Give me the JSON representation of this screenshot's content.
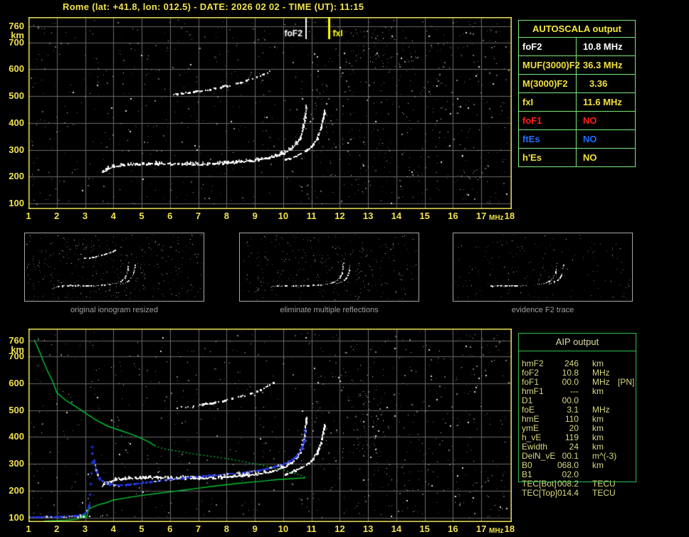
{
  "title": "Rome (lat: +41.8, lon: 012.5) - DATE: 2026 02 02 - TIME (UT): 11:15",
  "colors": {
    "background": "#000000",
    "axis_label": "#F0E24C",
    "plot_border": "#EFE45C",
    "grid": "#6A6A6A",
    "trace_white": "#FFFFFF",
    "trace_dim": "#C8C8C8",
    "noise_gray": "#8E8E8E",
    "noise_white": "#E8E8E8",
    "profile_green": "#00C832",
    "restored_blue": "#2438E6",
    "fof2_marker": "#FFFFFF",
    "fxi_marker": "#FFFF00",
    "autoscala_border": "#7CE87C",
    "autoscala_header": "#F5E93D",
    "aip_border": "#2FBF4F",
    "aip_text": "#D8D882",
    "white": "#FFFFFF",
    "yellow": "#F0E040",
    "red": "#FF2020",
    "blue": "#1E6EFF",
    "thumb_label": "#A0A0A0"
  },
  "axes": {
    "x_ticks": [
      1,
      2,
      3,
      4,
      5,
      6,
      7,
      8,
      9,
      10,
      11,
      12,
      13,
      14,
      15,
      16,
      17,
      18
    ],
    "x_unit": "MHz",
    "y_ticks": [
      760,
      700,
      600,
      500,
      400,
      300,
      200,
      100
    ],
    "y_unit": "km"
  },
  "autoscala": {
    "header": "AUTOSCALA output",
    "rows": [
      {
        "label": "foF2",
        "value": "10.8 MHz",
        "color": "white",
        "indent": false
      },
      {
        "label": "MUF(3000)F2",
        "value": "36.3 MHz",
        "color": "yellow",
        "indent": false
      },
      {
        "label": "M(3000)F2",
        "value": "3.36",
        "color": "yellow",
        "indent": true
      },
      {
        "label": "fxI",
        "value": "11.6 MHz",
        "color": "yellow",
        "indent": false
      },
      {
        "label": "foF1",
        "value": "NO",
        "color": "red",
        "indent": false
      },
      {
        "label": "ftEs",
        "value": "NO",
        "color": "blue",
        "indent": false
      },
      {
        "label": "h'Es",
        "value": "NO",
        "color": "yellow",
        "indent": false
      }
    ]
  },
  "aip": {
    "header": "AIP output",
    "rows": [
      {
        "name": "hmF2",
        "value": "246",
        "unit": "km",
        "extra": ""
      },
      {
        "name": "foF2",
        "value": "10.8",
        "unit": "MHz",
        "extra": ""
      },
      {
        "name": "foF1",
        "value": "00.0",
        "unit": "MHz",
        "extra": "[PN]"
      },
      {
        "name": "hmF1",
        "value": "---",
        "unit": "km",
        "extra": ""
      },
      {
        "name": "D1",
        "value": "00.0",
        "unit": "",
        "extra": ""
      },
      {
        "name": "foE",
        "value": "3.1",
        "unit": "MHz",
        "extra": ""
      },
      {
        "name": "hmE",
        "value": "110",
        "unit": "km",
        "extra": ""
      },
      {
        "name": "ymE",
        "value": "20",
        "unit": "km",
        "extra": ""
      },
      {
        "name": "h_vE",
        "value": "119",
        "unit": "km",
        "extra": ""
      },
      {
        "name": "Ewidth",
        "value": "24",
        "unit": "km",
        "extra": ""
      },
      {
        "name": "DelN_vE",
        "value": "00.1",
        "unit": "m^(-3)",
        "extra": ""
      },
      {
        "name": "B0",
        "value": "068.0",
        "unit": "km",
        "extra": ""
      },
      {
        "name": "B1",
        "value": "02.0",
        "unit": "",
        "extra": ""
      },
      {
        "name": "TEC[Bot]",
        "value": "008.2",
        "unit": "TECU",
        "extra": ""
      },
      {
        "name": "TEC[Top]",
        "value": "014.4",
        "unit": "TECU",
        "extra": ""
      }
    ]
  },
  "thumbnails": [
    {
      "label": "original ionogram resized",
      "traces": [
        {
          "id": "f2_ordinary",
          "ranges": [
            [
              1,
              18
            ]
          ]
        },
        {
          "id": "f2_extraordinary",
          "ranges": [
            [
              1,
              18
            ]
          ]
        },
        {
          "id": "second_reflection",
          "ranges": [
            [
              1,
              18
            ]
          ]
        }
      ],
      "noise": {
        "gray": 280,
        "white": 75,
        "seed": 71
      }
    },
    {
      "label": "eliminate multiple reflections",
      "traces": [
        {
          "id": "f2_ordinary",
          "ranges": [
            [
              1,
              18
            ]
          ]
        },
        {
          "id": "f2_extraordinary",
          "ranges": [
            [
              1,
              18
            ]
          ]
        }
      ],
      "noise": {
        "gray": 240,
        "white": 55,
        "seed": 72
      }
    },
    {
      "label": "evidence F2 trace",
      "traces": [
        {
          "id": "f2_ordinary",
          "ranges": [
            [
              4.6,
              7.7
            ],
            [
              9.1,
              10.8
            ]
          ]
        },
        {
          "id": "f2_extraordinary",
          "ranges": [
            [
              10.2,
              11.45
            ]
          ]
        }
      ],
      "noise": {
        "gray": 140,
        "white": 30,
        "seed": 73
      }
    }
  ],
  "chart_data": {
    "type": "scatter",
    "title": "ionogram (virtual height vs sounding frequency)",
    "xlabel": "MHz",
    "ylabel": "km",
    "xlim": [
      1,
      18
    ],
    "ylim": [
      100,
      760
    ],
    "grid": true,
    "markers": {
      "foF2": {
        "MHz": 10.78,
        "label": "foF2"
      },
      "fxI": {
        "MHz": 11.6,
        "label": "fxI"
      }
    },
    "traces": {
      "f2_ordinary": [
        [
          3.58,
          215
        ],
        [
          3.8,
          230
        ],
        [
          4.1,
          240
        ],
        [
          4.5,
          245
        ],
        [
          5.0,
          247
        ],
        [
          5.5,
          248
        ],
        [
          6.0,
          247
        ],
        [
          6.5,
          246
        ],
        [
          7.0,
          246
        ],
        [
          7.5,
          247
        ],
        [
          8.0,
          250
        ],
        [
          8.5,
          254
        ],
        [
          9.0,
          260
        ],
        [
          9.35,
          266
        ],
        [
          9.65,
          273
        ],
        [
          9.9,
          282
        ],
        [
          10.1,
          292
        ],
        [
          10.3,
          306
        ],
        [
          10.45,
          322
        ],
        [
          10.57,
          342
        ],
        [
          10.66,
          368
        ],
        [
          10.73,
          400
        ],
        [
          10.77,
          436
        ],
        [
          10.79,
          468
        ]
      ],
      "f2_extraordinary": [
        [
          10.05,
          262
        ],
        [
          10.3,
          270
        ],
        [
          10.55,
          281
        ],
        [
          10.8,
          296
        ],
        [
          11.0,
          314
        ],
        [
          11.15,
          336
        ],
        [
          11.27,
          365
        ],
        [
          11.36,
          400
        ],
        [
          11.42,
          430
        ],
        [
          11.45,
          447
        ]
      ],
      "second_reflection": [
        [
          6.1,
          506
        ],
        [
          6.6,
          512
        ],
        [
          7.1,
          520
        ],
        [
          7.6,
          529
        ],
        [
          8.0,
          538
        ],
        [
          8.4,
          548
        ],
        [
          8.75,
          558
        ],
        [
          9.05,
          569
        ],
        [
          9.3,
          581
        ],
        [
          9.5,
          592
        ],
        [
          9.62,
          601
        ]
      ],
      "e_trace_low": [
        [
          2.3,
          101
        ],
        [
          2.6,
          102
        ],
        [
          2.9,
          103
        ],
        [
          3.15,
          104
        ]
      ]
    },
    "profile": {
      "bottomside": [
        [
          1.55,
          86
        ],
        [
          2.0,
          88
        ],
        [
          2.4,
          90
        ],
        [
          2.7,
          93
        ],
        [
          2.85,
          99
        ],
        [
          2.92,
          106
        ],
        [
          2.97,
          110
        ],
        [
          3.0,
          104
        ],
        [
          3.04,
          99
        ],
        [
          3.07,
          104
        ],
        [
          3.1,
          122
        ],
        [
          3.15,
          132
        ],
        [
          3.3,
          140
        ],
        [
          3.5,
          148
        ],
        [
          3.75,
          155
        ],
        [
          4.0,
          165
        ],
        [
          4.5,
          174
        ],
        [
          5.0,
          182
        ],
        [
          5.5,
          189
        ],
        [
          6.0,
          195
        ],
        [
          6.5,
          202
        ],
        [
          7.0,
          209
        ],
        [
          7.5,
          216
        ],
        [
          8.0,
          222
        ],
        [
          8.5,
          228
        ],
        [
          9.0,
          233
        ],
        [
          9.4,
          237
        ],
        [
          9.8,
          241
        ],
        [
          10.2,
          244
        ],
        [
          10.5,
          246
        ],
        [
          10.7,
          247
        ],
        [
          10.78,
          248
        ]
      ],
      "topside_solid": [
        [
          1.2,
          762
        ],
        [
          1.3,
          740
        ],
        [
          1.42,
          710
        ],
        [
          1.55,
          675
        ],
        [
          1.7,
          640
        ],
        [
          1.85,
          608
        ],
        [
          2.0,
          565
        ],
        [
          2.3,
          538
        ],
        [
          2.6,
          518
        ],
        [
          3.0,
          490
        ],
        [
          3.4,
          462
        ],
        [
          3.8,
          440
        ],
        [
          4.25,
          424
        ],
        [
          4.75,
          406
        ],
        [
          5.25,
          382
        ],
        [
          5.45,
          368
        ]
      ],
      "topside_dotted": [
        [
          5.45,
          368
        ],
        [
          5.8,
          355
        ],
        [
          6.2,
          348
        ],
        [
          6.6,
          341
        ],
        [
          7.0,
          334
        ],
        [
          7.5,
          327
        ],
        [
          8.0,
          319
        ],
        [
          8.4,
          312
        ],
        [
          8.8,
          304
        ],
        [
          9.2,
          296
        ],
        [
          9.6,
          287
        ],
        [
          10.0,
          277
        ],
        [
          10.3,
          268
        ],
        [
          10.55,
          260
        ],
        [
          10.7,
          254
        ],
        [
          10.78,
          248
        ]
      ]
    },
    "restored_trace": {
      "flat": [
        [
          1.0,
          101
        ],
        [
          1.3,
          101
        ],
        [
          1.6,
          102
        ],
        [
          1.9,
          102
        ],
        [
          2.2,
          103
        ],
        [
          2.5,
          104
        ],
        [
          2.7,
          106
        ],
        [
          2.85,
          109
        ],
        [
          2.95,
          114
        ],
        [
          3.02,
          121
        ],
        [
          3.07,
          130
        ],
        [
          3.11,
          141
        ],
        [
          3.14,
          153
        ]
      ],
      "asymptote": [
        [
          3.16,
          185
        ],
        [
          3.19,
          225
        ],
        [
          3.21,
          265
        ],
        [
          3.23,
          305
        ],
        [
          3.24,
          340
        ],
        [
          3.25,
          363
        ]
      ],
      "main": [
        [
          3.3,
          312
        ],
        [
          3.35,
          282
        ],
        [
          3.42,
          259
        ],
        [
          3.5,
          244
        ],
        [
          3.6,
          234
        ],
        [
          3.72,
          227
        ],
        [
          3.85,
          223
        ],
        [
          4.0,
          221
        ],
        [
          4.2,
          220
        ],
        [
          4.45,
          221
        ],
        [
          4.7,
          224
        ],
        [
          5.0,
          228
        ],
        [
          5.3,
          232
        ],
        [
          5.6,
          236
        ],
        [
          6.0,
          241
        ],
        [
          6.4,
          246
        ],
        [
          6.8,
          250
        ],
        [
          7.2,
          254
        ],
        [
          7.6,
          257
        ],
        [
          8.0,
          261
        ],
        [
          8.4,
          265
        ],
        [
          8.8,
          270
        ],
        [
          9.1,
          275
        ],
        [
          9.4,
          281
        ],
        [
          9.7,
          289
        ],
        [
          9.95,
          297
        ],
        [
          10.15,
          306
        ],
        [
          10.32,
          317
        ],
        [
          10.46,
          330
        ],
        [
          10.57,
          346
        ],
        [
          10.65,
          365
        ],
        [
          10.7,
          386
        ],
        [
          10.74,
          407
        ],
        [
          10.77,
          428
        ]
      ]
    },
    "plots": [
      {
        "id": "top",
        "markers": true,
        "profile": false,
        "noise": {
          "gray": 640,
          "white": 140,
          "seed": 11,
          "clusters": [
            {
              "f": [
                11,
                17.9
              ],
              "km": [
                100,
                760
              ],
              "n": 240
            },
            {
              "f": [
                12.6,
                14.6
              ],
              "km": [
                600,
                755
              ],
              "n": 60
            }
          ]
        },
        "white_traces": [
          "f2_ordinary",
          "f2_extraordinary",
          "second_reflection"
        ]
      },
      {
        "id": "bottom",
        "markers": false,
        "profile": true,
        "noise": {
          "gray": 580,
          "white": 120,
          "seed": 22,
          "clusters": [
            {
              "f": [
                11,
                17.9
              ],
              "km": [
                100,
                760
              ],
              "n": 200
            },
            {
              "f": [
                12.4,
                13.6
              ],
              "km": [
                350,
                620
              ],
              "n": 45
            }
          ]
        },
        "white_traces": [
          "f2_ordinary",
          "f2_extraordinary",
          "second_reflection",
          "e_trace_low"
        ]
      }
    ]
  }
}
